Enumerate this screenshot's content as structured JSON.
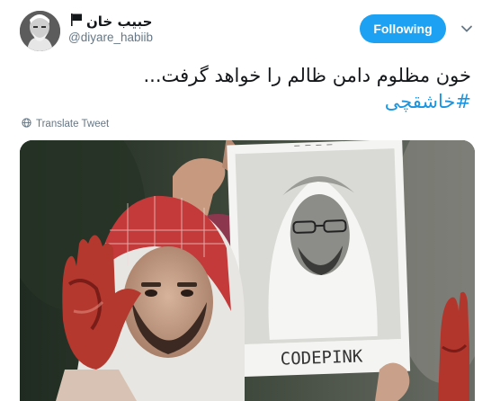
{
  "author": {
    "display_name": "حبیب خان",
    "handle": "@diyare_habiib",
    "flag_icon": "black-flag-icon"
  },
  "actions": {
    "follow_label": "Following",
    "menu_icon": "chevron-down-icon"
  },
  "tweet": {
    "text": "خون مظلوم دامن ظالم را خواهد گرفت...",
    "hashtag": "#خاشقچی"
  },
  "translate": {
    "label": "Translate Tweet",
    "icon": "globe-icon"
  },
  "media": {
    "sign_text": "CODEPINK"
  },
  "colors": {
    "accent": "#1da1f2",
    "hashtag": "#1b95e0",
    "muted": "#657786"
  }
}
